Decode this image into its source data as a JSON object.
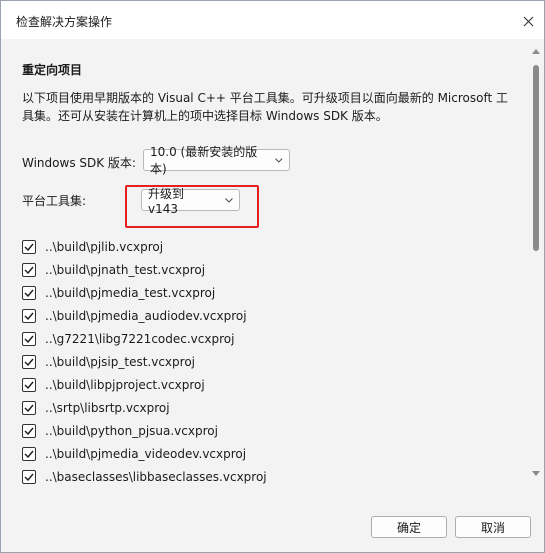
{
  "window": {
    "title": "检查解决方案操作"
  },
  "section": {
    "title": "重定向项目",
    "description": "以下项目使用早期版本的 Visual C++ 平台工具集。可升级项目以面向最新的 Microsoft 工具集。还可从安装在计算机上的项中选择目标 Windows SDK 版本。"
  },
  "sdk": {
    "label": "Windows SDK 版本:",
    "value": "10.0 (最新安装的版本)"
  },
  "toolset": {
    "label": "平台工具集:",
    "value": "升级到 v143"
  },
  "projects": [
    "..\\build\\pjlib.vcxproj",
    "..\\build\\pjnath_test.vcxproj",
    "..\\build\\pjmedia_test.vcxproj",
    "..\\build\\pjmedia_audiodev.vcxproj",
    "..\\g7221\\libg7221codec.vcxproj",
    "..\\build\\pjsip_test.vcxproj",
    "..\\build\\libpjproject.vcxproj",
    "..\\srtp\\libsrtp.vcxproj",
    "..\\build\\python_pjsua.vcxproj",
    "..\\build\\pjmedia_videodev.vcxproj",
    "..\\baseclasses\\libbaseclasses.vcxproj"
  ],
  "buttons": {
    "ok": "确定",
    "cancel": "取消"
  },
  "colors": {
    "highlight": "#e81f1f",
    "window_bg": "#f3f3f3"
  }
}
